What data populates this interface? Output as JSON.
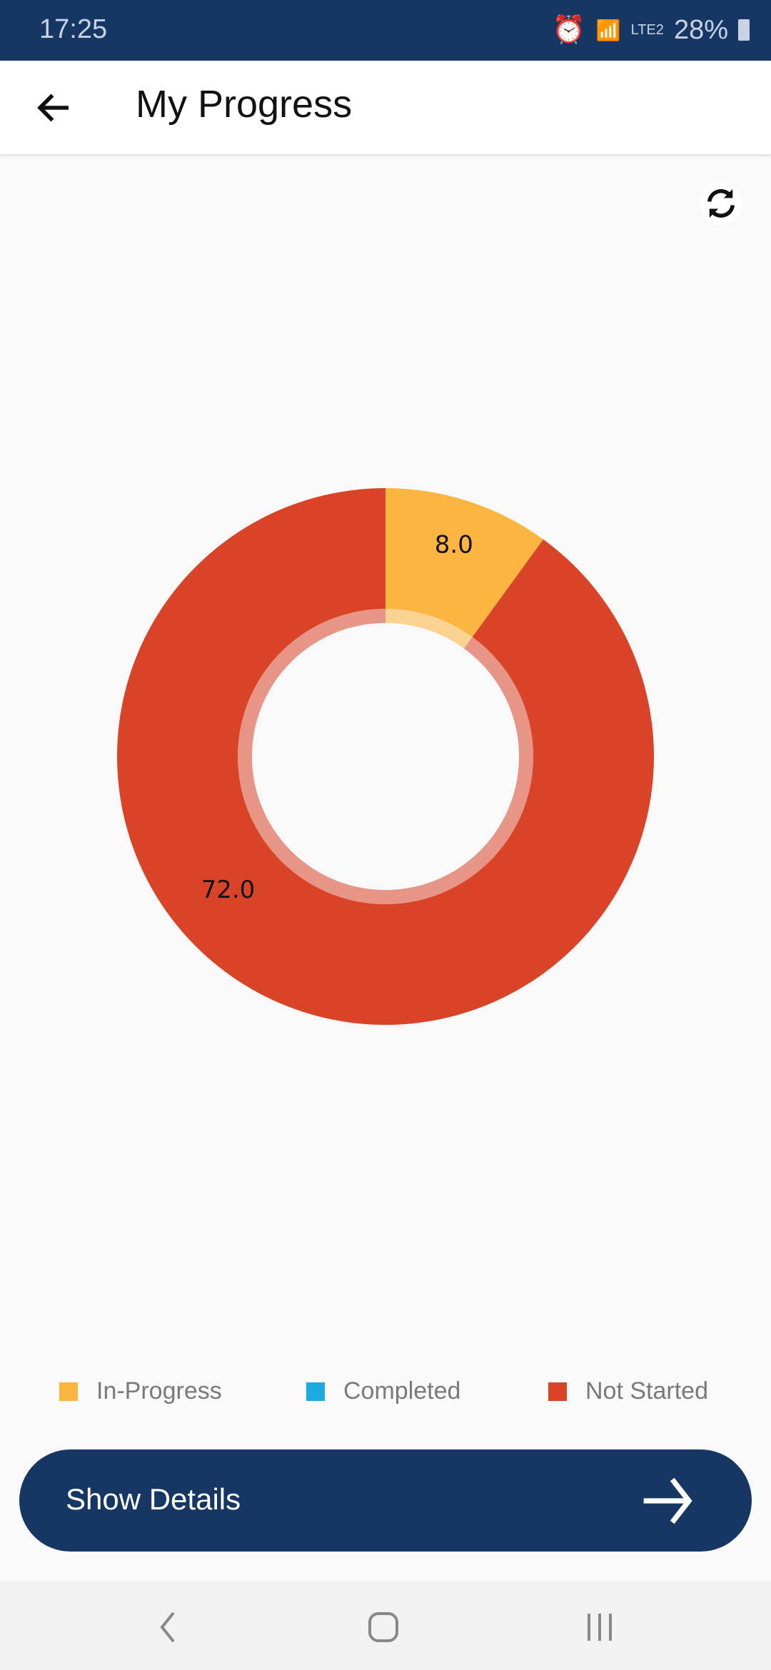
{
  "status_bar": {
    "time": "17:25",
    "battery": "28%",
    "network": "LTE2"
  },
  "app_bar": {
    "title": "My Progress"
  },
  "chart_data": {
    "type": "pie",
    "donut": true,
    "categories": [
      "In-Progress",
      "Completed",
      "Not Started"
    ],
    "values": [
      8.0,
      0,
      72.0
    ],
    "data_labels": [
      "8.0",
      "",
      "72.0"
    ],
    "colors": [
      "#FBB540",
      "#1DA9E1",
      "#D94428"
    ],
    "legend_position": "bottom"
  },
  "button": {
    "label": "Show Details"
  },
  "colors": {
    "primary": "#163663"
  }
}
